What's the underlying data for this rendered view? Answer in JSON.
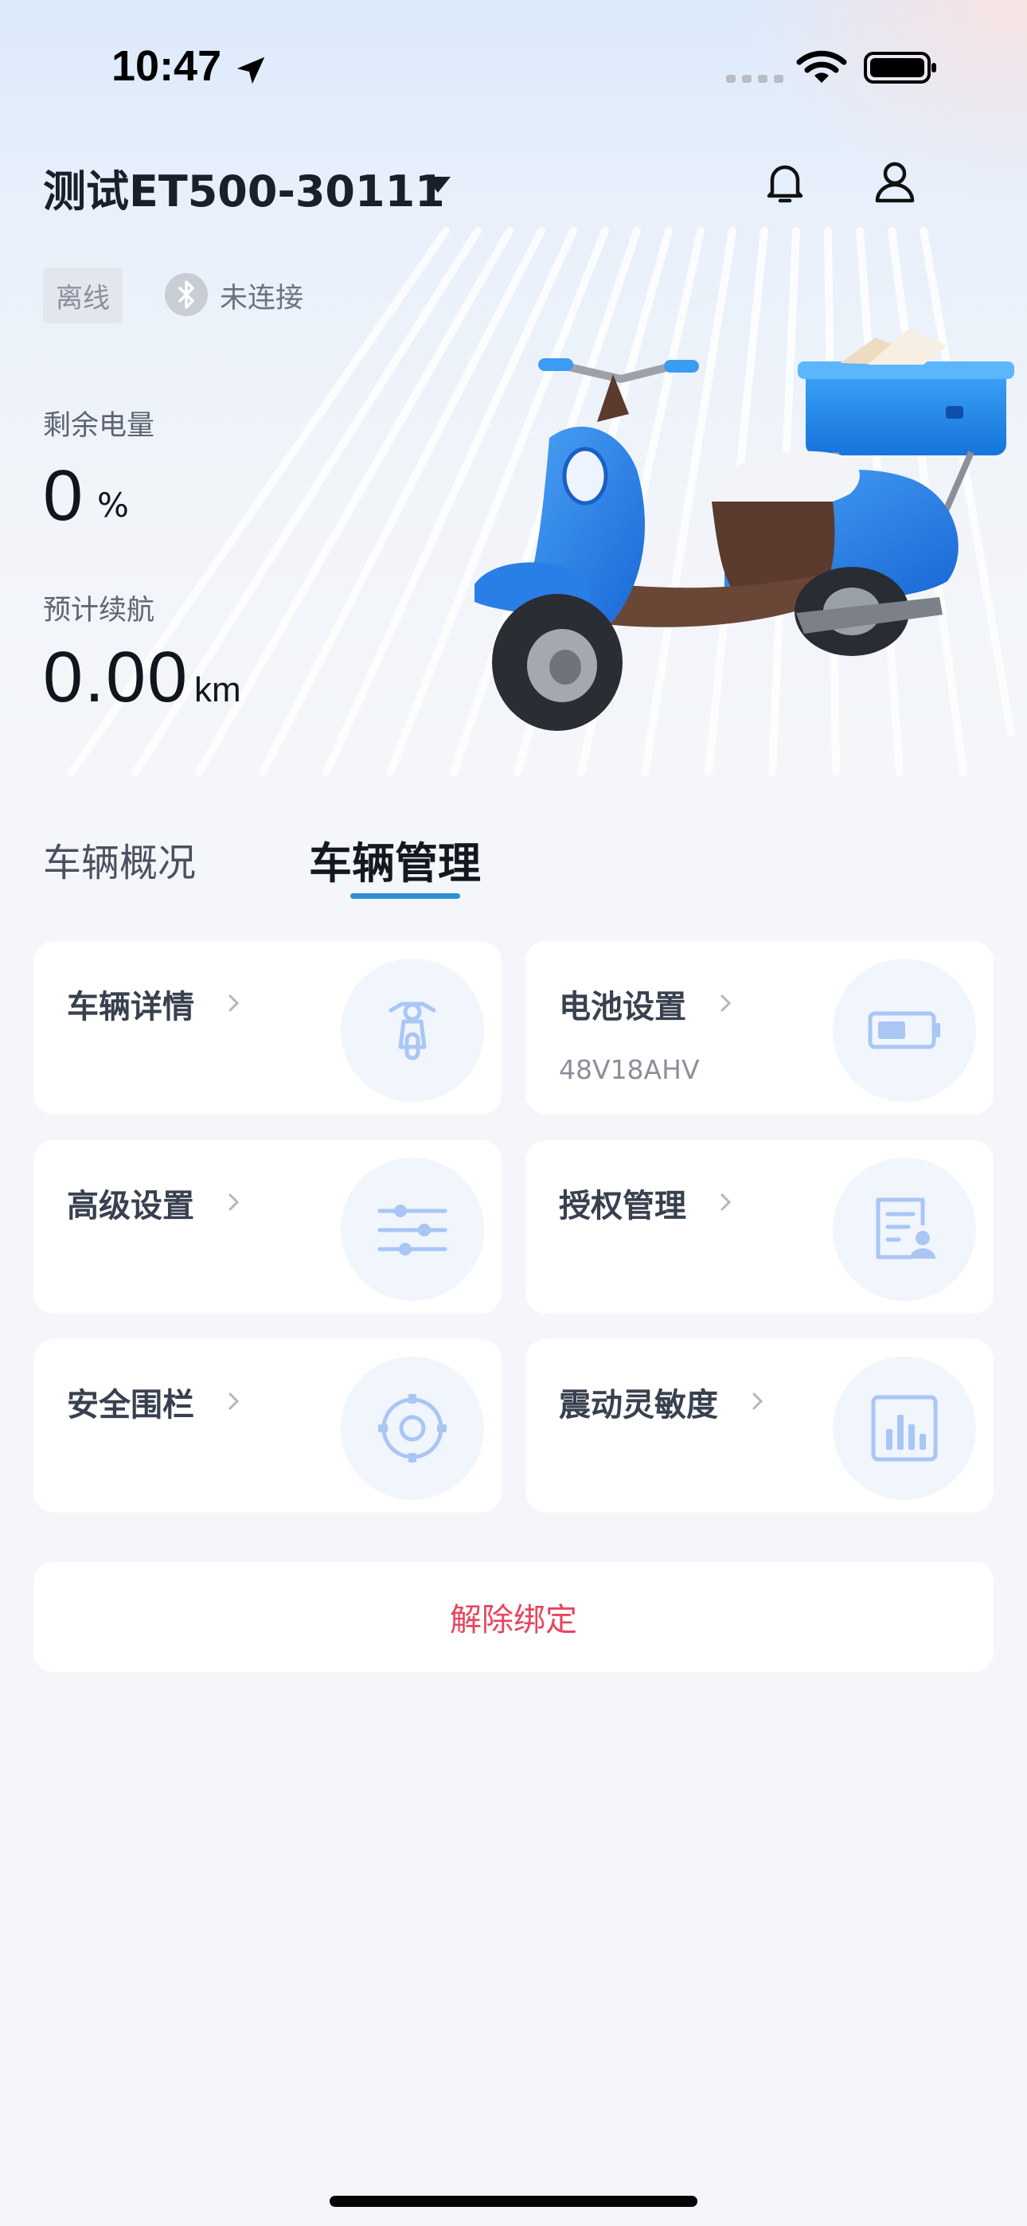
{
  "status_bar": {
    "time": "10:47"
  },
  "header": {
    "device_name": "测试ET500-30111"
  },
  "status": {
    "online_badge": "离线",
    "bluetooth_text": "未连接"
  },
  "metrics": {
    "power_label": "剩余电量",
    "power_value": "0",
    "power_unit": "%",
    "range_label": "预计续航",
    "range_value": "0.00",
    "range_unit": "km"
  },
  "tabs": [
    {
      "label": "车辆概况",
      "active": false
    },
    {
      "label": "车辆管理",
      "active": true
    }
  ],
  "cards": [
    {
      "title": "车辆详情",
      "subtitle": "",
      "icon": "scooter-icon"
    },
    {
      "title": "电池设置",
      "subtitle": "48V18AHV",
      "icon": "battery-icon"
    },
    {
      "title": "高级设置",
      "subtitle": "",
      "icon": "sliders-icon"
    },
    {
      "title": "授权管理",
      "subtitle": "",
      "icon": "authorization-doc-icon"
    },
    {
      "title": "安全围栏",
      "subtitle": "",
      "icon": "geofence-target-icon"
    },
    {
      "title": "震动灵敏度",
      "subtitle": "",
      "icon": "bar-chart-icon"
    }
  ],
  "actions": {
    "unbind_label": "解除绑定"
  },
  "colors": {
    "accent": "#2e8fd8",
    "danger": "#e8455e",
    "icon_tint": "#a9c6f5",
    "card_bg": "#ffffff",
    "page_bg": "#f4f6f9"
  }
}
